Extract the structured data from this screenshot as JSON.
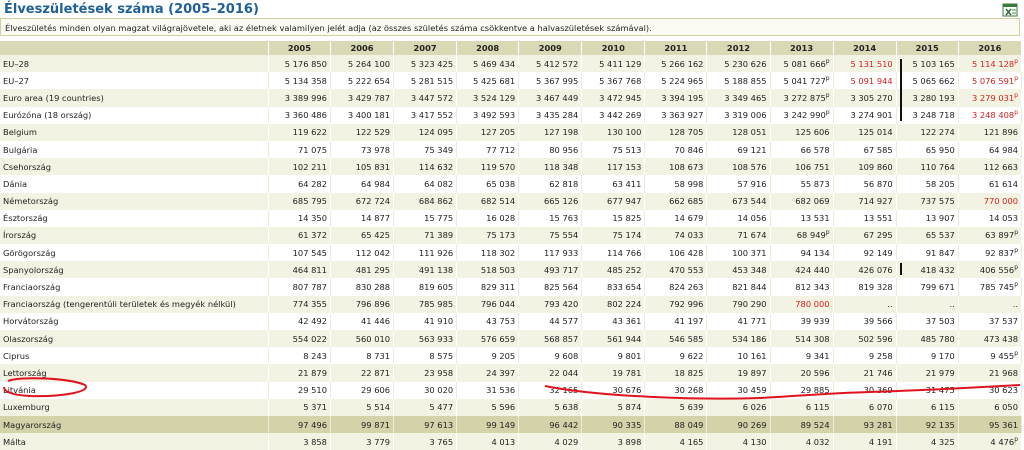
{
  "title": "Élveszületések száma (2005–2016)",
  "description": "Élveszületés minden olyan magzat világrajövetele, aki az életnek valamilyen jelét adja (az összes születés száma csökkentve a halvaszületések számával).",
  "icons": {
    "export": "excel-export-icon"
  },
  "columns": [
    "2005",
    "2006",
    "2007",
    "2008",
    "2009",
    "2010",
    "2011",
    "2012",
    "2013",
    "2014",
    "2015",
    "2016"
  ],
  "rows": [
    {
      "label": "EU–28",
      "values": [
        "5 176 850",
        "5 264 100",
        "5 323 425",
        "5 469 434",
        "5 412 572",
        "5 411 129",
        "5 266 162",
        "5 230 626",
        "5 081 666",
        "5 131 510",
        "5 103 165",
        "5 114 128"
      ],
      "flags": [
        "",
        "",
        "",
        "",
        "",
        "",
        "",
        "",
        "p",
        "",
        "",
        "p"
      ]
    },
    {
      "label": "EU–27",
      "values": [
        "5 134 358",
        "5 222 654",
        "5 281 515",
        "5 425 681",
        "5 367 995",
        "5 367 768",
        "5 224 965",
        "5 188 855",
        "5 041 727",
        "5 091 944",
        "5 065 662",
        "5 076 591"
      ],
      "flags": [
        "",
        "",
        "",
        "",
        "",
        "",
        "",
        "",
        "p",
        "",
        "",
        "p"
      ]
    },
    {
      "label": "Euro area (19 countries)",
      "values": [
        "3 389 996",
        "3 429 787",
        "3 447 572",
        "3 524 129",
        "3 467 449",
        "3 472 945",
        "3 394 195",
        "3 349 465",
        "3 272 875",
        "3 305 270",
        "3 280 193",
        "3 279 031"
      ],
      "flags": [
        "",
        "",
        "",
        "",
        "",
        "",
        "",
        "",
        "p",
        "",
        "",
        "p"
      ]
    },
    {
      "label": "Eurózóna (18 ország)",
      "values": [
        "3 360 486",
        "3 400 181",
        "3 417 552",
        "3 492 593",
        "3 435 284",
        "3 442 269",
        "3 363 927",
        "3 319 006",
        "3 242 990",
        "3 274 901",
        "3 248 718",
        "3 248 408"
      ],
      "flags": [
        "",
        "",
        "",
        "",
        "",
        "",
        "",
        "",
        "p",
        "",
        "",
        "p"
      ]
    },
    {
      "label": "Belgium",
      "values": [
        "119 622",
        "122 529",
        "124 095",
        "127 205",
        "127 198",
        "130 100",
        "128 705",
        "128 051",
        "125 606",
        "125 014",
        "122 274",
        "121 896"
      ],
      "flags": [
        "",
        "",
        "",
        "",
        "",
        "",
        "",
        "",
        "",
        "",
        "",
        ""
      ]
    },
    {
      "label": "Bulgária",
      "values": [
        "71 075",
        "73 978",
        "75 349",
        "77 712",
        "80 956",
        "75 513",
        "70 846",
        "69 121",
        "66 578",
        "67 585",
        "65 950",
        "64 984"
      ],
      "flags": [
        "",
        "",
        "",
        "",
        "",
        "",
        "",
        "",
        "",
        "",
        "",
        ""
      ]
    },
    {
      "label": "Csehország",
      "values": [
        "102 211",
        "105 831",
        "114 632",
        "119 570",
        "118 348",
        "117 153",
        "108 673",
        "108 576",
        "106 751",
        "109 860",
        "110 764",
        "112 663"
      ],
      "flags": [
        "",
        "",
        "",
        "",
        "",
        "",
        "",
        "",
        "",
        "",
        "",
        ""
      ]
    },
    {
      "label": "Dánia",
      "values": [
        "64 282",
        "64 984",
        "64 082",
        "65 038",
        "62 818",
        "63 411",
        "58 998",
        "57 916",
        "55 873",
        "56 870",
        "58 205",
        "61 614"
      ],
      "flags": [
        "",
        "",
        "",
        "",
        "",
        "",
        "",
        "",
        "",
        "",
        "",
        ""
      ]
    },
    {
      "label": "Németország",
      "values": [
        "685 795",
        "672 724",
        "684 862",
        "682 514",
        "665 126",
        "677 947",
        "662 685",
        "673 544",
        "682 069",
        "714 927",
        "737 575",
        "770 000"
      ],
      "flags": [
        "",
        "",
        "",
        "",
        "",
        "",
        "",
        "",
        "",
        "",
        "",
        ""
      ]
    },
    {
      "label": "Észtország",
      "values": [
        "14 350",
        "14 877",
        "15 775",
        "16 028",
        "15 763",
        "15 825",
        "14 679",
        "14 056",
        "13 531",
        "13 551",
        "13 907",
        "14 053"
      ],
      "flags": [
        "",
        "",
        "",
        "",
        "",
        "",
        "",
        "",
        "",
        "",
        "",
        ""
      ]
    },
    {
      "label": "Írország",
      "values": [
        "61 372",
        "65 425",
        "71 389",
        "75 173",
        "75 554",
        "75 174",
        "74 033",
        "71 674",
        "68 949",
        "67 295",
        "65 537",
        "63 897"
      ],
      "flags": [
        "",
        "",
        "",
        "",
        "",
        "",
        "",
        "",
        "p",
        "",
        "",
        "p"
      ]
    },
    {
      "label": "Görögország",
      "values": [
        "107 545",
        "112 042",
        "111 926",
        "118 302",
        "117 933",
        "114 766",
        "106 428",
        "100 371",
        "94 134",
        "92 149",
        "91 847",
        "92 837"
      ],
      "flags": [
        "",
        "",
        "",
        "",
        "",
        "",
        "",
        "",
        "",
        "",
        "",
        "p"
      ]
    },
    {
      "label": "Spanyolország",
      "values": [
        "464 811",
        "481 295",
        "491 138",
        "518 503",
        "493 717",
        "485 252",
        "470 553",
        "453 348",
        "424 440",
        "426 076",
        "418 432",
        "406 556"
      ],
      "flags": [
        "",
        "",
        "",
        "",
        "",
        "",
        "",
        "",
        "",
        "",
        "",
        "p"
      ]
    },
    {
      "label": "Franciaország",
      "values": [
        "807 787",
        "830 288",
        "819 605",
        "829 311",
        "825 564",
        "833 654",
        "824 263",
        "821 844",
        "812 343",
        "819 328",
        "799 671",
        "785 745"
      ],
      "flags": [
        "",
        "",
        "",
        "",
        "",
        "",
        "",
        "",
        "",
        "",
        "",
        "p"
      ]
    },
    {
      "label": "Franciaország (tengerentúli területek és megyék nélkül)",
      "values": [
        "774 355",
        "796 896",
        "785 985",
        "796 044",
        "793 420",
        "802 224",
        "792 996",
        "790 290",
        "780 000",
        "..",
        "..",
        ".."
      ],
      "flags": [
        "",
        "",
        "",
        "",
        "",
        "",
        "",
        "",
        "",
        "",
        "",
        ""
      ]
    },
    {
      "label": "Horvátország",
      "values": [
        "42 492",
        "41 446",
        "41 910",
        "43 753",
        "44 577",
        "43 361",
        "41 197",
        "41 771",
        "39 939",
        "39 566",
        "37 503",
        "37 537"
      ],
      "flags": [
        "",
        "",
        "",
        "",
        "",
        "",
        "",
        "",
        "",
        "",
        "",
        ""
      ]
    },
    {
      "label": "Olaszország",
      "values": [
        "554 022",
        "560 010",
        "563 933",
        "576 659",
        "568 857",
        "561 944",
        "546 585",
        "534 186",
        "514 308",
        "502 596",
        "485 780",
        "473 438"
      ],
      "flags": [
        "",
        "",
        "",
        "",
        "",
        "",
        "",
        "",
        "",
        "",
        "",
        ""
      ]
    },
    {
      "label": "Ciprus",
      "values": [
        "8 243",
        "8 731",
        "8 575",
        "9 205",
        "9 608",
        "9 801",
        "9 622",
        "10 161",
        "9 341",
        "9 258",
        "9 170",
        "9 455"
      ],
      "flags": [
        "",
        "",
        "",
        "",
        "",
        "",
        "",
        "",
        "",
        "",
        "",
        "p"
      ]
    },
    {
      "label": "Lettország",
      "values": [
        "21 879",
        "22 871",
        "23 958",
        "24 397",
        "22 044",
        "19 781",
        "18 825",
        "19 897",
        "20 596",
        "21 746",
        "21 979",
        "21 968"
      ],
      "flags": [
        "",
        "",
        "",
        "",
        "",
        "",
        "",
        "",
        "",
        "",
        "",
        ""
      ]
    },
    {
      "label": "Litvánia",
      "values": [
        "29 510",
        "29 606",
        "30 020",
        "31 536",
        "32 165",
        "30 676",
        "30 268",
        "30 459",
        "29 885",
        "30 369",
        "31 475",
        "30 623"
      ],
      "flags": [
        "",
        "",
        "",
        "",
        "",
        "",
        "",
        "",
        "",
        "",
        "",
        ""
      ]
    },
    {
      "label": "Luxemburg",
      "values": [
        "5 371",
        "5 514",
        "5 477",
        "5 596",
        "5 638",
        "5 874",
        "5 639",
        "6 026",
        "6 115",
        "6 070",
        "6 115",
        "6 050"
      ],
      "flags": [
        "",
        "",
        "",
        "",
        "",
        "",
        "",
        "",
        "",
        "",
        "",
        ""
      ]
    },
    {
      "label": "Magyarország",
      "values": [
        "97 496",
        "99 871",
        "97 613",
        "99 149",
        "96 442",
        "90 335",
        "88 049",
        "90 269",
        "89 524",
        "93 281",
        "92 135",
        "95 361"
      ],
      "flags": [
        "",
        "",
        "",
        "",
        "",
        "",
        "",
        "",
        "",
        "",
        "",
        ""
      ]
    },
    {
      "label": "Málta",
      "values": [
        "3 858",
        "3 779",
        "3 765",
        "4 013",
        "4 029",
        "3 898",
        "4 165",
        "4 130",
        "4 032",
        "4 191",
        "4 325",
        "4 476"
      ],
      "flags": [
        "",
        "",
        "",
        "",
        "",
        "",
        "",
        "",
        "",
        "",
        "",
        "p"
      ]
    }
  ],
  "red_cells": [
    [
      0,
      9
    ],
    [
      0,
      11
    ],
    [
      1,
      9
    ],
    [
      1,
      11
    ],
    [
      2,
      11
    ],
    [
      3,
      11
    ],
    [
      8,
      11
    ],
    [
      14,
      8
    ]
  ],
  "highlighted_row": "Magyarország",
  "colors": {
    "title": "#1f5f9a",
    "header_bg": "#d9d9b5",
    "odd_row": "#f3f3e3",
    "highlight_row": "#d3d2a9",
    "red_value": "#d62020",
    "annotation": "#e0141e"
  }
}
